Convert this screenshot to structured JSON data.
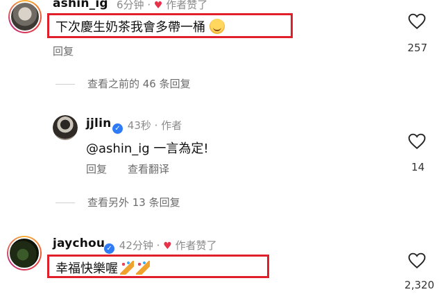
{
  "comments": [
    {
      "username": "ashin_ig",
      "time": "6分钟",
      "separator": "·",
      "author_liked": "作者赞了",
      "text": "下次慶生奶茶我會多帶一桶",
      "emoji": "smiling-face-emoji",
      "reply_label": "回复",
      "like_count": "257"
    },
    {
      "username": "jjlin",
      "verified": true,
      "time": "43秒",
      "separator": "·",
      "author_tag": "作者",
      "text": "@ashin_ig 一言為定!",
      "reply_label": "回复",
      "translate_label": "查看翻译",
      "like_count": "14"
    },
    {
      "username": "jaychou",
      "verified": true,
      "time": "42分钟",
      "separator": "·",
      "author_liked": "作者赞了",
      "text": "幸福快樂喔",
      "emoji": "party-popper-emoji",
      "like_count": "2,320"
    }
  ],
  "view_previous": "查看之前的 46 条回复",
  "view_other": "查看另外 13 条回复",
  "colors": {
    "highlight": "#e11f2b",
    "verified": "#2f7bf5",
    "heart": "#e7334a",
    "meta": "#8a8a8a"
  }
}
